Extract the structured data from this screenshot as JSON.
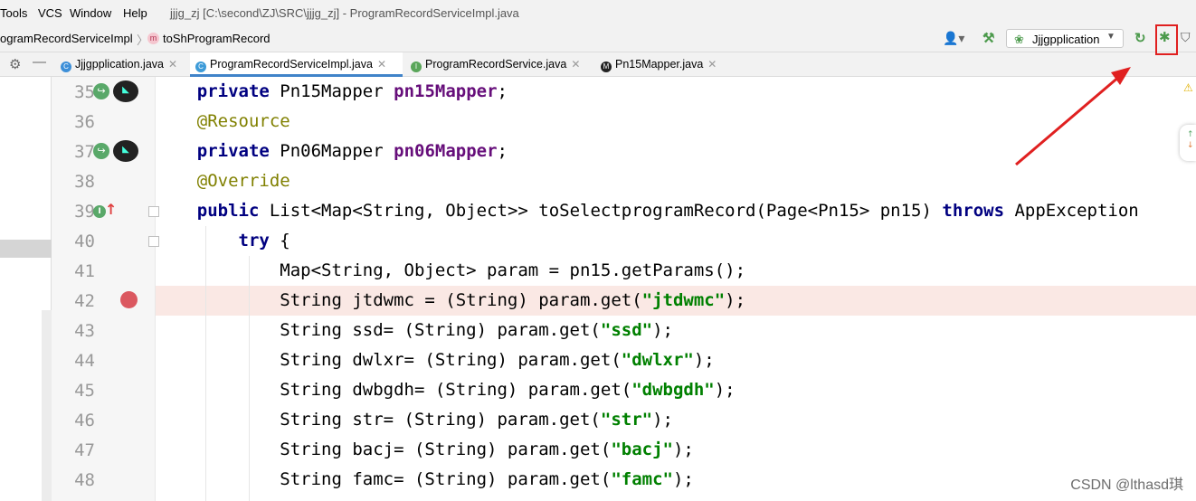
{
  "menubar": {
    "items": [
      "Tools",
      "VCS",
      "Window",
      "Help"
    ],
    "title": "jjjg_zj [C:\\second\\ZJ\\SRC\\jjjg_zj] - ProgramRecordServiceImpl.java"
  },
  "navbar": {
    "breadcrumb": [
      "ogramRecordServiceImpl",
      "toShProgramRecord"
    ],
    "method_badge": "m",
    "run_config": "Jjjgpplication"
  },
  "tabs": [
    {
      "label": "Jjjgpplication.java",
      "icon": "spring-class-icon",
      "color": "#3d8fd8"
    },
    {
      "label": "ProgramRecordServiceImpl.java",
      "icon": "class-icon",
      "color": "#3d9bd8",
      "active": true
    },
    {
      "label": "ProgramRecordService.java",
      "icon": "interface-icon",
      "color": "#5aa65a"
    },
    {
      "label": "Pn15Mapper.java",
      "icon": "mybatis-icon",
      "color": "#222"
    }
  ],
  "editor": {
    "line_numbers": [
      "35",
      "36",
      "37",
      "38",
      "39",
      "40",
      "41",
      "42",
      "43",
      "44",
      "45",
      "46",
      "47",
      "48"
    ],
    "breakpoint_line": "42",
    "lines": [
      [
        [
          "    ",
          ""
        ],
        [
          "private",
          "kw"
        ],
        [
          " Pn15Mapper ",
          ""
        ],
        [
          "pn15Mapper",
          "fld"
        ],
        [
          ";",
          ""
        ]
      ],
      [
        [
          "    ",
          ""
        ],
        [
          "@Resource",
          "ann"
        ]
      ],
      [
        [
          "    ",
          ""
        ],
        [
          "private",
          "kw"
        ],
        [
          " Pn06Mapper ",
          ""
        ],
        [
          "pn06Mapper",
          "fld"
        ],
        [
          ";",
          ""
        ]
      ],
      [
        [
          "    ",
          ""
        ],
        [
          "@Override",
          "ann"
        ]
      ],
      [
        [
          "    ",
          ""
        ],
        [
          "public",
          "kw"
        ],
        [
          " List<Map<String, Object>> toSelectprogramRecord(Page<Pn15> pn15) ",
          ""
        ],
        [
          "throws",
          "kw"
        ],
        [
          " AppException",
          ""
        ]
      ],
      [
        [
          "        ",
          ""
        ],
        [
          "try",
          "kw"
        ],
        [
          " {",
          ""
        ]
      ],
      [
        [
          "            Map<String, Object> param = pn15.getParams();",
          ""
        ]
      ],
      [
        [
          "            String jtdwmc = (String) param.get(",
          ""
        ],
        [
          "\"jtdwmc\"",
          "str"
        ],
        [
          ");",
          ""
        ]
      ],
      [
        [
          "            String ssd= (String) param.get(",
          ""
        ],
        [
          "\"ssd\"",
          "str"
        ],
        [
          ");",
          ""
        ]
      ],
      [
        [
          "            String dwlxr= (String) param.get(",
          ""
        ],
        [
          "\"dwlxr\"",
          "str"
        ],
        [
          ");",
          ""
        ]
      ],
      [
        [
          "            String dwbgdh= (String) param.get(",
          ""
        ],
        [
          "\"dwbgdh\"",
          "str"
        ],
        [
          ");",
          ""
        ]
      ],
      [
        [
          "            String str= (String) param.get(",
          ""
        ],
        [
          "\"str\"",
          "str"
        ],
        [
          ");",
          ""
        ]
      ],
      [
        [
          "            String bacj= (String) param.get(",
          ""
        ],
        [
          "\"bacj\"",
          "str"
        ],
        [
          ");",
          ""
        ]
      ],
      [
        [
          "            String famc= (String) param.get(",
          ""
        ],
        [
          "\"famc\"",
          "str"
        ],
        [
          ");",
          ""
        ]
      ]
    ]
  },
  "watermark": "CSDN @lthasd琪"
}
